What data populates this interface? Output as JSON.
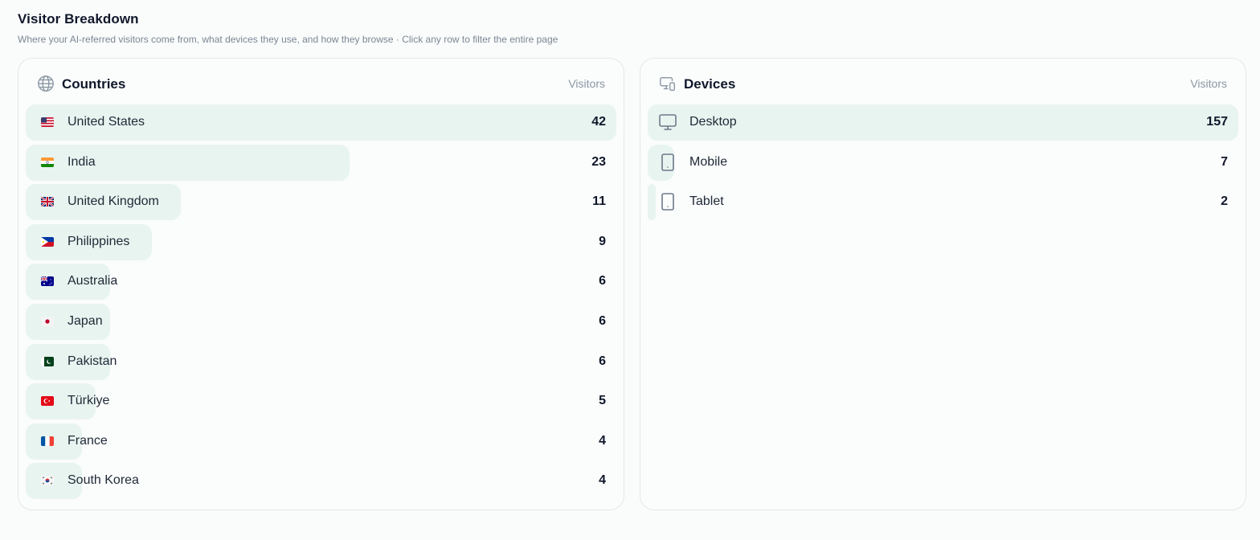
{
  "header": {
    "title": "Visitor Breakdown",
    "subtitle": "Where your AI-referred visitors come from, what devices they use, and how they browse · Click any row to filter the entire page"
  },
  "countries": {
    "title": "Countries",
    "column_label": "Visitors",
    "icon": "globe-icon",
    "bar_color": "#e8f4f0",
    "items": [
      {
        "name": "United States",
        "count": "42",
        "share": 1.0,
        "flag": "us"
      },
      {
        "name": "India",
        "count": "23",
        "share": 0.548,
        "flag": "in"
      },
      {
        "name": "United Kingdom",
        "count": "11",
        "share": 0.262,
        "flag": "gb"
      },
      {
        "name": "Philippines",
        "count": "9",
        "share": 0.214,
        "flag": "ph"
      },
      {
        "name": "Australia",
        "count": "6",
        "share": 0.143,
        "flag": "au"
      },
      {
        "name": "Japan",
        "count": "6",
        "share": 0.143,
        "flag": "jp"
      },
      {
        "name": "Pakistan",
        "count": "6",
        "share": 0.143,
        "flag": "pk"
      },
      {
        "name": "Türkiye",
        "count": "5",
        "share": 0.119,
        "flag": "tr"
      },
      {
        "name": "France",
        "count": "4",
        "share": 0.095,
        "flag": "fr"
      },
      {
        "name": "South Korea",
        "count": "4",
        "share": 0.095,
        "flag": "kr"
      }
    ]
  },
  "devices": {
    "title": "Devices",
    "column_label": "Visitors",
    "icon": "devices-icon",
    "items": [
      {
        "name": "Desktop",
        "count": "157",
        "share": 1.0,
        "icon": "desktop-icon"
      },
      {
        "name": "Mobile",
        "count": "7",
        "share": 0.045,
        "icon": "mobile-icon"
      },
      {
        "name": "Tablet",
        "count": "2",
        "share": 0.013,
        "icon": "tablet-icon"
      }
    ]
  }
}
